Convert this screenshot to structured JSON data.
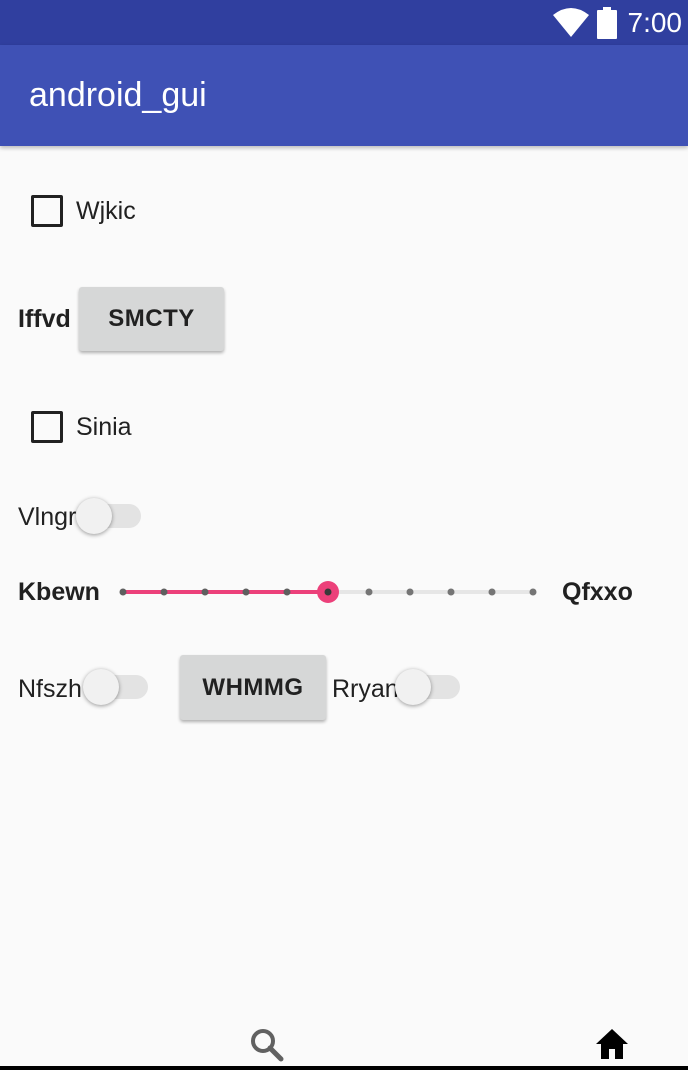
{
  "status_bar": {
    "time": "7:00",
    "wifi_icon": "wifi-icon",
    "battery_icon": "battery-icon"
  },
  "app_bar": {
    "title": "android_gui"
  },
  "form": {
    "checkbox_1": {
      "label": "Wjkic",
      "checked": false
    },
    "row_2": {
      "label": "Iffvd",
      "button_label": "SMCTY"
    },
    "checkbox_2": {
      "label": "Sinia",
      "checked": false
    },
    "switch_1": {
      "label": "Vlngr",
      "on": false
    },
    "slider": {
      "left_label": "Kbewn",
      "right_label": "Qfxxo",
      "value": 5,
      "max": 10
    },
    "row_6": {
      "switch_label": "Nfszh",
      "switch_on": false,
      "button_label": "WHMMG",
      "switch_2_label": "Rryan",
      "switch_2_on": false
    }
  },
  "bottom_nav": {
    "items": [
      {
        "icon": "search-icon"
      },
      {
        "icon": "home-icon"
      }
    ]
  },
  "colors": {
    "status_bar": "#303f9f",
    "app_bar": "#3f51b5",
    "accent": "#ec407a"
  }
}
